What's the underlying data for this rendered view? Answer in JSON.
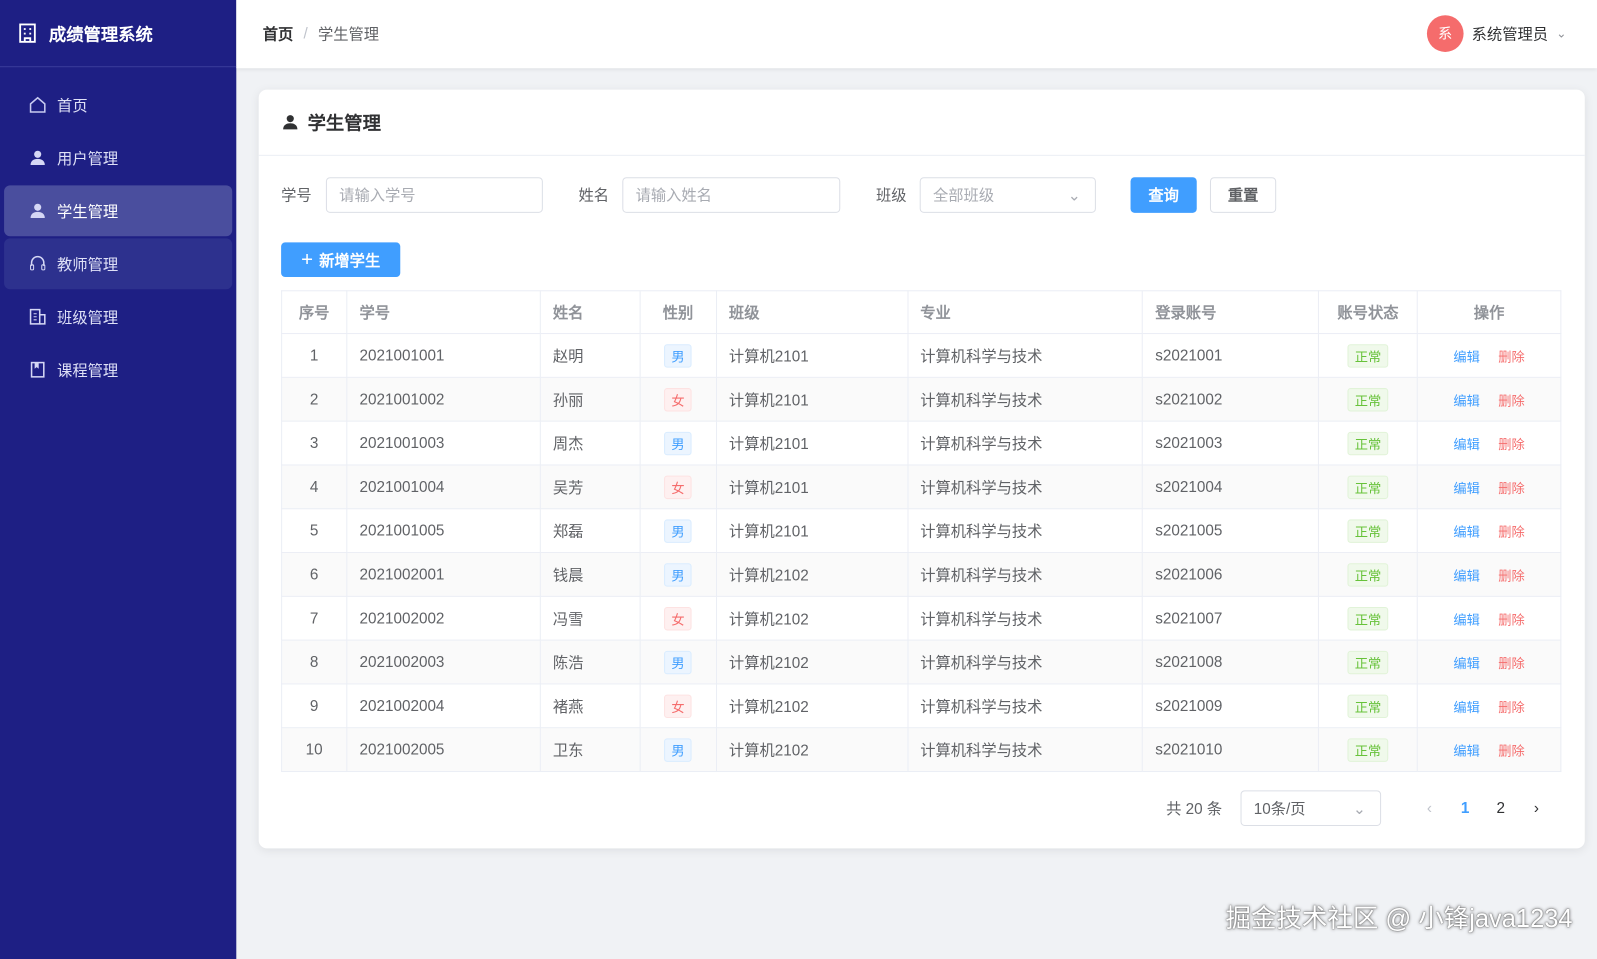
{
  "app": {
    "title": "成绩管理系统"
  },
  "sidebar": {
    "items": [
      {
        "label": "首页",
        "icon": "home-icon"
      },
      {
        "label": "用户管理",
        "icon": "user-icon"
      },
      {
        "label": "学生管理",
        "icon": "user-icon"
      },
      {
        "label": "教师管理",
        "icon": "headset-icon"
      },
      {
        "label": "班级管理",
        "icon": "building-icon"
      },
      {
        "label": "课程管理",
        "icon": "book-icon"
      }
    ]
  },
  "header": {
    "breadcrumb": [
      "首页",
      "学生管理"
    ],
    "separator": "/",
    "avatar": "系",
    "user": "系统管理员"
  },
  "card": {
    "title": "学生管理"
  },
  "filters": {
    "id_label": "学号",
    "id_placeholder": "请输入学号",
    "name_label": "姓名",
    "name_placeholder": "请输入姓名",
    "class_label": "班级",
    "class_value": "全部班级",
    "search": "查询",
    "reset": "重置"
  },
  "add_button": "新增学生",
  "table": {
    "columns": [
      "序号",
      "学号",
      "姓名",
      "性别",
      "班级",
      "专业",
      "登录账号",
      "账号状态",
      "操作"
    ],
    "rows": [
      [
        "1",
        "2021001001",
        "赵明",
        "男",
        "计算机2101",
        "计算机科学与技术",
        "s2021001",
        "正常"
      ],
      [
        "2",
        "2021001002",
        "孙丽",
        "女",
        "计算机2101",
        "计算机科学与技术",
        "s2021002",
        "正常"
      ],
      [
        "3",
        "2021001003",
        "周杰",
        "男",
        "计算机2101",
        "计算机科学与技术",
        "s2021003",
        "正常"
      ],
      [
        "4",
        "2021001004",
        "吴芳",
        "女",
        "计算机2101",
        "计算机科学与技术",
        "s2021004",
        "正常"
      ],
      [
        "5",
        "2021001005",
        "郑磊",
        "男",
        "计算机2101",
        "计算机科学与技术",
        "s2021005",
        "正常"
      ],
      [
        "6",
        "2021002001",
        "钱晨",
        "男",
        "计算机2102",
        "计算机科学与技术",
        "s2021006",
        "正常"
      ],
      [
        "7",
        "2021002002",
        "冯雪",
        "女",
        "计算机2102",
        "计算机科学与技术",
        "s2021007",
        "正常"
      ],
      [
        "8",
        "2021002003",
        "陈浩",
        "男",
        "计算机2102",
        "计算机科学与技术",
        "s2021008",
        "正常"
      ],
      [
        "9",
        "2021002004",
        "褚燕",
        "女",
        "计算机2102",
        "计算机科学与技术",
        "s2021009",
        "正常"
      ],
      [
        "10",
        "2021002005",
        "卫东",
        "男",
        "计算机2102",
        "计算机科学与技术",
        "s2021010",
        "正常"
      ]
    ],
    "edit": "编辑",
    "delete": "删除"
  },
  "pagination": {
    "total": "共 20 条",
    "page_size": "10条/页",
    "pages": [
      "1",
      "2"
    ],
    "current": "1"
  },
  "watermark": "掘金技术社区 @ 小锋java1234"
}
